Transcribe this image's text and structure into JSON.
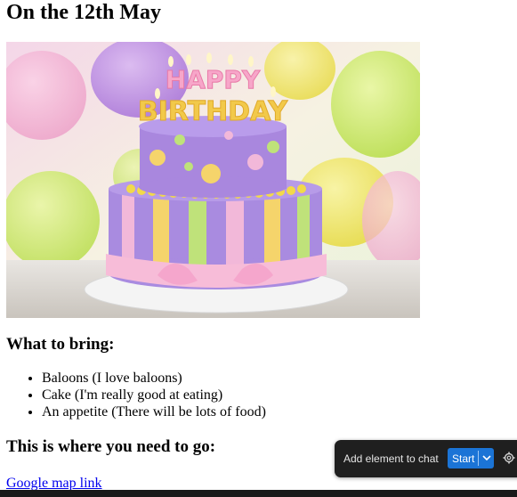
{
  "page": {
    "heading": "On the 12th May",
    "image_alt": "Happy Birthday cake",
    "cake_text": "HAPPY BIRTHDAY"
  },
  "bring": {
    "heading": "What to bring:",
    "items": [
      "Baloons (I love baloons)",
      "Cake (I'm really good at eating)",
      "An appetite (There will be lots of food)"
    ]
  },
  "directions": {
    "heading": "This is where you need to go:",
    "link_text": "Google map link"
  },
  "chat_toolbar": {
    "label": "Add element to chat",
    "start_label": "Start",
    "chevron_icon": "chevron-down-icon",
    "settings_icon": "gear-icon"
  }
}
